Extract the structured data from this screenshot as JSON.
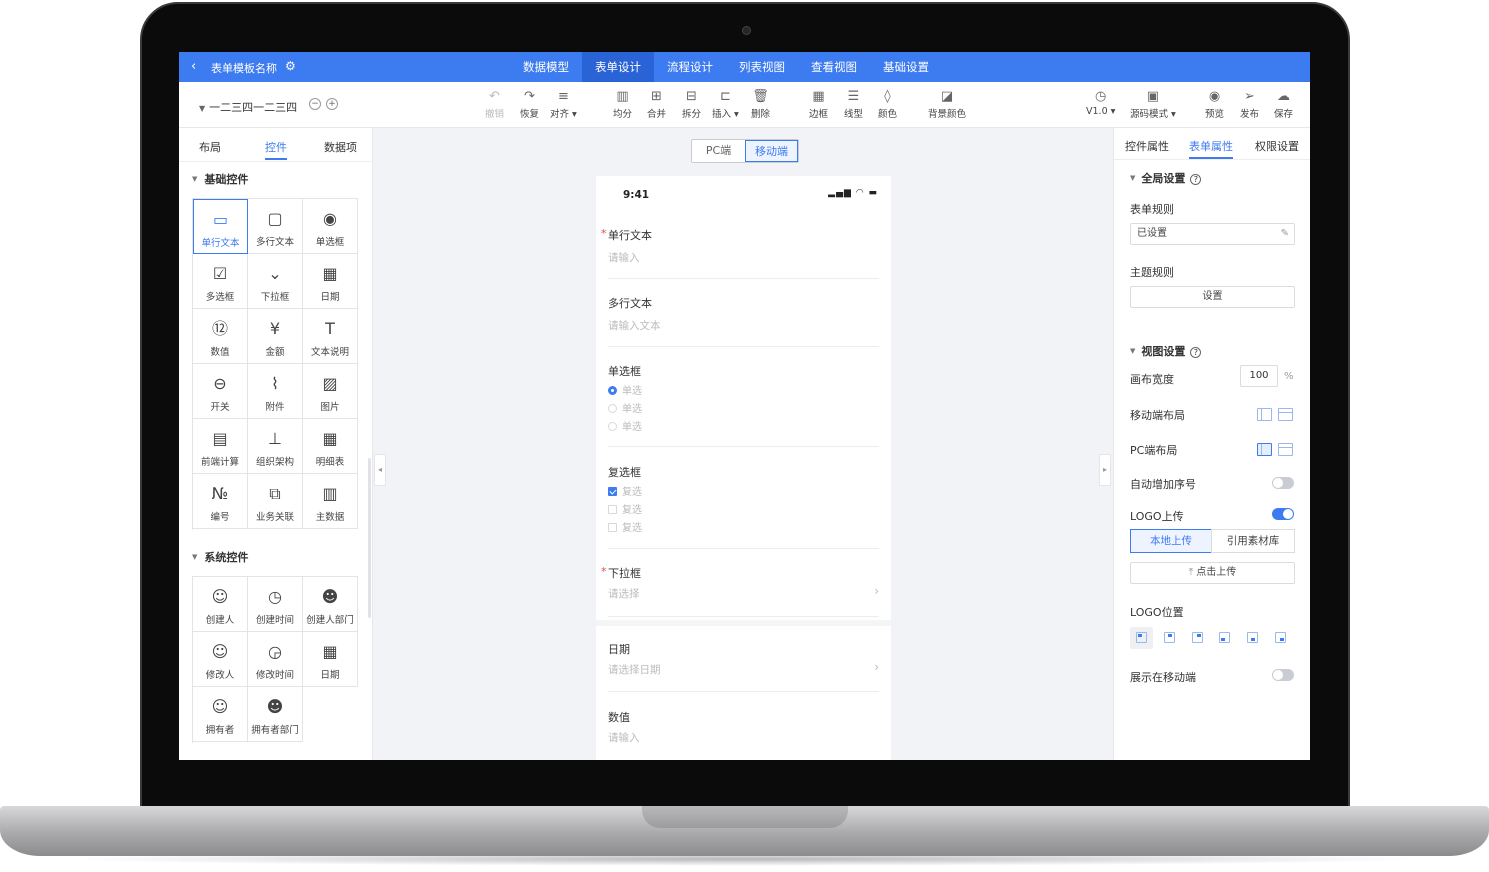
{
  "app": {
    "back_icon": "chevron-left-icon",
    "template_name": "表单模板名称",
    "gear_icon": "gear-icon"
  },
  "nav": {
    "items": [
      "数据模型",
      "表单设计",
      "流程设计",
      "列表视图",
      "查看视图",
      "基础设置"
    ],
    "active": "表单设计"
  },
  "page": {
    "name": "一二三四一二三四"
  },
  "toolbar": {
    "undo": "撤销",
    "redo": "恢复",
    "align": "对齐",
    "avg": "均分",
    "merge": "合并",
    "split": "拆分",
    "insert": "插入",
    "delete": "删除",
    "border": "边框",
    "line": "线型",
    "color": "颜色",
    "bgcolor": "背景颜色",
    "version": "V1.0",
    "source": "源码模式",
    "preview": "预览",
    "publish": "发布",
    "save": "保存"
  },
  "left": {
    "tabs": [
      "布局",
      "控件",
      "数据项"
    ],
    "active_tab": "控件",
    "basic_title": "基础控件",
    "basic": [
      {
        "label": "单行文本",
        "icon": "single-line-text-icon"
      },
      {
        "label": "多行文本",
        "icon": "multi-line-text-icon"
      },
      {
        "label": "单选框",
        "icon": "radio-icon"
      },
      {
        "label": "多选框",
        "icon": "checkbox-icon"
      },
      {
        "label": "下拉框",
        "icon": "dropdown-icon"
      },
      {
        "label": "日期",
        "icon": "calendar-icon"
      },
      {
        "label": "数值",
        "icon": "number-icon"
      },
      {
        "label": "金额",
        "icon": "yen-icon"
      },
      {
        "label": "文本说明",
        "icon": "text-description-icon"
      },
      {
        "label": "开关",
        "icon": "switch-icon"
      },
      {
        "label": "附件",
        "icon": "paperclip-icon"
      },
      {
        "label": "图片",
        "icon": "image-icon"
      },
      {
        "label": "前端计算",
        "icon": "calculator-icon"
      },
      {
        "label": "组织架构",
        "icon": "org-chart-icon"
      },
      {
        "label": "明细表",
        "icon": "table-icon"
      },
      {
        "label": "编号",
        "icon": "serial-number-icon"
      },
      {
        "label": "业务关联",
        "icon": "business-link-icon"
      },
      {
        "label": "主数据",
        "icon": "master-data-icon"
      }
    ],
    "system_title": "系统控件",
    "system": [
      {
        "label": "创建人",
        "icon": "user-icon"
      },
      {
        "label": "创建时间",
        "icon": "clock-icon"
      },
      {
        "label": "创建人部门",
        "icon": "user-group-icon"
      },
      {
        "label": "修改人",
        "icon": "user-edit-icon"
      },
      {
        "label": "修改时间",
        "icon": "clock-edit-icon"
      },
      {
        "label": "日期",
        "icon": "calendar-icon"
      },
      {
        "label": "拥有者",
        "icon": "owner-icon"
      },
      {
        "label": "拥有者部门",
        "icon": "owner-group-icon"
      }
    ]
  },
  "canvas": {
    "seg": [
      "PC端",
      "移动端"
    ],
    "active_seg": "移动端",
    "time": "9:41",
    "fields": {
      "f1_label": "单行文本",
      "f1_ph": "请输入",
      "f2_label": "多行文本",
      "f2_ph": "请输入文本",
      "f3_label": "单选框",
      "radio_opts": [
        "单选",
        "单选",
        "单选"
      ],
      "f4_label": "复选框",
      "check_opts": [
        "复选",
        "复选",
        "复选"
      ],
      "f5_label": "下拉框",
      "f5_ph": "请选择",
      "f6_label": "日期",
      "f6_ph": "请选择日期",
      "f7_label": "数值",
      "f7_ph": "请输入"
    }
  },
  "right": {
    "tabs": [
      "控件属性",
      "表单属性",
      "权限设置"
    ],
    "active_tab": "表单属性",
    "global_title": "全局设置",
    "form_rule_label": "表单规则",
    "form_rule_value": "已设置",
    "theme_rule_label": "主题规则",
    "theme_rule_btn": "设置",
    "view_title": "视图设置",
    "canvas_width_label": "画布宽度",
    "canvas_width": "100",
    "canvas_unit": "%",
    "mobile_layout_label": "移动端布局",
    "pc_layout_label": "PC端布局",
    "auto_seq_label": "自动增加序号",
    "auto_seq": false,
    "logo_label": "LOGO上传",
    "logo_on": true,
    "local_upload": "本地上传",
    "library": "引用素材库",
    "click_upload": "点击上传",
    "logo_pos_label": "LOGO位置",
    "mobile_show_label": "展示在移动端",
    "mobile_show": false
  }
}
